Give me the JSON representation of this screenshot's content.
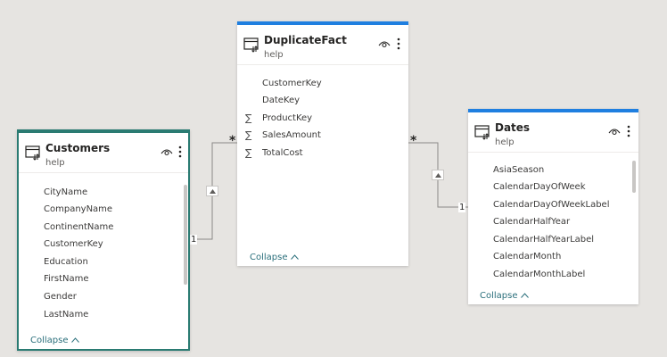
{
  "tables": {
    "customers": {
      "title": "Customers",
      "subtitle": "help",
      "fields": [
        "CityName",
        "CompanyName",
        "ContinentName",
        "CustomerKey",
        "Education",
        "FirstName",
        "Gender",
        "LastName"
      ],
      "collapse_label": "Collapse"
    },
    "duplicatefact": {
      "title": "DuplicateFact",
      "subtitle": "help",
      "fields": [
        {
          "name": "CustomerKey",
          "aggregate": ""
        },
        {
          "name": "DateKey",
          "aggregate": ""
        },
        {
          "name": "ProductKey",
          "aggregate": "∑"
        },
        {
          "name": "SalesAmount",
          "aggregate": "∑"
        },
        {
          "name": "TotalCost",
          "aggregate": "∑"
        }
      ],
      "collapse_label": "Collapse"
    },
    "dates": {
      "title": "Dates",
      "subtitle": "help",
      "fields": [
        "AsiaSeason",
        "CalendarDayOfWeek",
        "CalendarDayOfWeekLabel",
        "CalendarHalfYear",
        "CalendarHalfYearLabel",
        "CalendarMonth",
        "CalendarMonthLabel"
      ],
      "collapse_label": "Collapse"
    }
  },
  "relationships": [
    {
      "from": "Customers",
      "to": "DuplicateFact",
      "from_cardinality": "1",
      "to_cardinality": "*"
    },
    {
      "from": "Dates",
      "to": "DuplicateFact",
      "from_cardinality": "1",
      "to_cardinality": "*"
    }
  ],
  "colors": {
    "accent_blue": "#1f7fe0",
    "selected_border": "#2a7b72",
    "canvas": "#e6e4e1"
  }
}
